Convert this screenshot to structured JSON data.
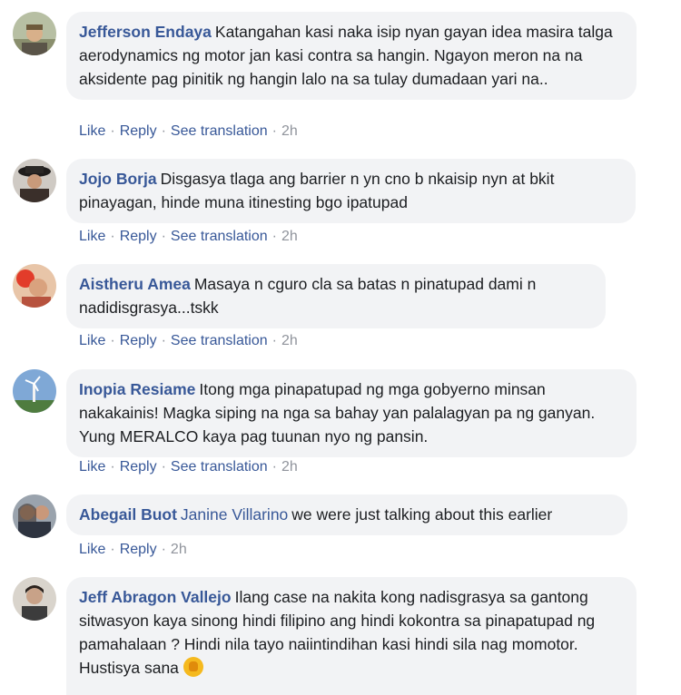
{
  "comments": [
    {
      "author": "Jefferson Endaya",
      "text": "Katangahan kasi naka isip nyan gayan idea masira talga aerodynamics ng motor jan kasi contra sa hangin. Ngayon meron na na aksidente pag pinitik ng hangin lalo na sa tulay dumadaan yari na..",
      "like": "Like",
      "reply": "Reply",
      "translate": "See translation",
      "time": "2h"
    },
    {
      "author": "Jojo Borja",
      "text": "Disgasya tlaga ang barrier n yn cno b nkaisip nyn at bkit pinayagan, hinde muna itinesting bgo ipatupad",
      "like": "Like",
      "reply": "Reply",
      "translate": "See translation",
      "time": "2h"
    },
    {
      "author": "Aistheru Amea",
      "text": "Masaya n cguro cla sa batas n pinatupad dami n nadidisgrasya...tskk",
      "like": "Like",
      "reply": "Reply",
      "translate": "See translation",
      "time": "2h"
    },
    {
      "author": "Inopia Resiame",
      "text": "Itong mga pinapatupad ng mga gobyerno minsan nakakainis! Magka siping na nga sa bahay yan palalagyan pa ng ganyan. Yung MERALCO kaya pag tuunan nyo ng pansin.",
      "like": "Like",
      "reply": "Reply",
      "translate": "See translation",
      "time": "2h"
    },
    {
      "author": "Abegail Buot",
      "mention": "Janine Villarino",
      "text": "we were just talking about this earlier",
      "like": "Like",
      "reply": "Reply",
      "time": "2h"
    },
    {
      "author": "Jeff Abragon Vallejo",
      "text": "Ilang case na nakita kong nadisgrasya sa gantong sitwasyon kaya sinong hindi filipino ang hindi kokontra sa pinapatupad ng pamahalaan ? Hindi nila tayo naiintindihan kasi hindi sila nag momotor. Hustisya sana",
      "emoji": "fist-emoji"
    }
  ],
  "colors": {
    "link": "#385898",
    "bubble": "#f2f3f5",
    "meta": "#90949c",
    "text": "#1c1e21"
  }
}
